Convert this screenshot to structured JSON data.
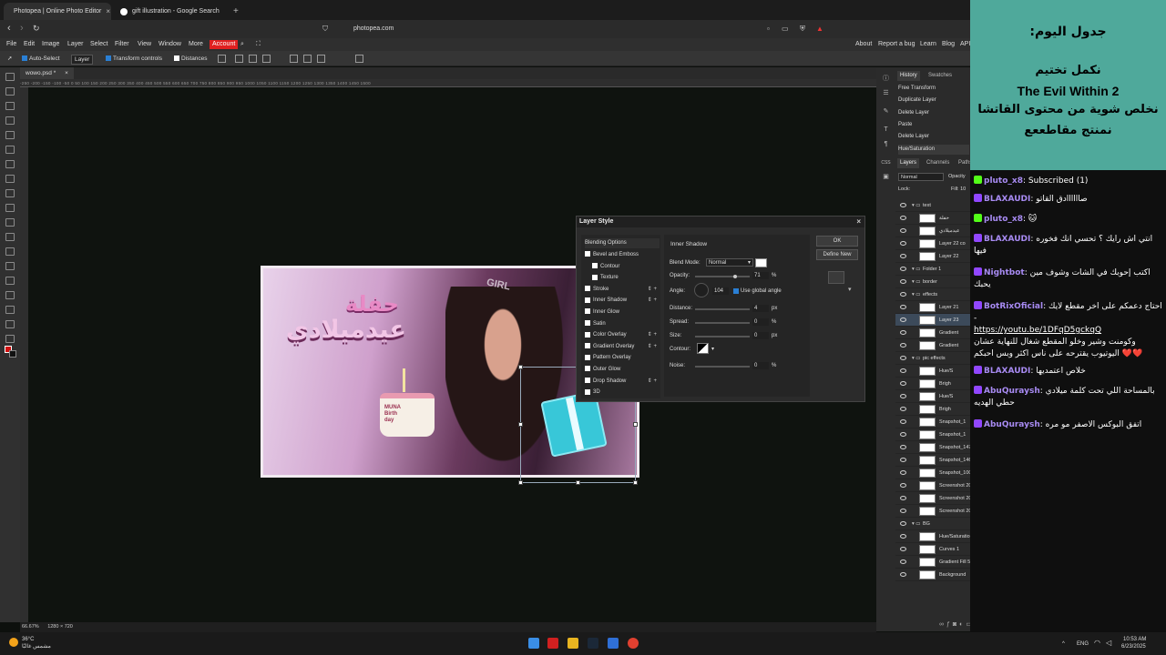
{
  "browser": {
    "tabs": [
      {
        "label": "Photopea | Online Photo Editor",
        "close": "×"
      },
      {
        "label": "gift illustration - Google Search",
        "close": "×"
      }
    ],
    "new_tab": "+",
    "url": "photopea.com"
  },
  "menu": {
    "items": [
      "File",
      "Edit",
      "Image",
      "Layer",
      "Select",
      "Filter",
      "View",
      "Window",
      "More"
    ],
    "account": "Account",
    "right_links": [
      "About",
      "Report a bug",
      "Learn",
      "Blog",
      "API"
    ]
  },
  "options": {
    "auto_select": "Auto-Select",
    "layer_select": "Layer",
    "transform_controls": "Transform controls",
    "distances": "Distances"
  },
  "document": {
    "tab": "wowo.psd *",
    "ruler": "-250 -200 -150 -100 -50 0 50 100 150 200 250 300 350 400 450 500 550 600 650 700 750 800 850 900 950 1000 1050 1100 1150 1200 1250 1300 1350 1400 1450 1500",
    "zoom": "66.67%",
    "size": "1280 × 720"
  },
  "artwork": {
    "title_line1": "حفلة",
    "title_line2": "عيدميلادي",
    "tiara": "GIRL",
    "cake_text": "MUNA\nBirth\nday"
  },
  "dialog": {
    "title": "Layer Style",
    "close": "×",
    "blending_options": "Blending Options",
    "styles": [
      {
        "label": "Bevel and Emboss",
        "indent": false,
        "plus": false
      },
      {
        "label": "Contour",
        "indent": true,
        "plus": false
      },
      {
        "label": "Texture",
        "indent": true,
        "plus": false
      },
      {
        "label": "Stroke",
        "indent": false,
        "plus": true
      },
      {
        "label": "Inner Shadow",
        "indent": false,
        "plus": true
      },
      {
        "label": "Inner Glow",
        "indent": false,
        "plus": false
      },
      {
        "label": "Satin",
        "indent": false,
        "plus": false
      },
      {
        "label": "Color Overlay",
        "indent": false,
        "plus": true
      },
      {
        "label": "Gradient Overlay",
        "indent": false,
        "plus": true
      },
      {
        "label": "Pattern Overlay",
        "indent": false,
        "plus": false
      },
      {
        "label": "Outer Glow",
        "indent": false,
        "plus": false
      },
      {
        "label": "Drop Shadow",
        "indent": false,
        "plus": true
      },
      {
        "label": "3D",
        "indent": false,
        "plus": false
      }
    ],
    "section": "Inner Shadow",
    "blend_mode_label": "Blend Mode:",
    "blend_mode": "Normal",
    "opacity_label": "Opacity:",
    "opacity": "71",
    "angle_label": "Angle:",
    "angle": "104",
    "global_angle": "Use global angle",
    "distance_label": "Distance:",
    "distance": "4",
    "spread_label": "Spread:",
    "spread": "0",
    "size_label": "Size:",
    "size": "0",
    "contour_label": "Contour:",
    "noise_label": "Noise:",
    "noise": "0",
    "unit_px": "px",
    "unit_pct": "%",
    "ok": "OK",
    "define_new": "Define New"
  },
  "history": {
    "tabs": [
      "History",
      "Swatches"
    ],
    "items": [
      "Free Transform",
      "Duplicate Layer",
      "Delete Layer",
      "Paste",
      "Delete Layer",
      "Hue/Saturation"
    ]
  },
  "layers": {
    "tabs": [
      "Layers",
      "Channels",
      "Paths"
    ],
    "blend": "Normal",
    "opacity_label": "Opacity",
    "lock_label": "Lock:",
    "fill_label": "Fill: 10",
    "items": [
      "text",
      "حفلة",
      "عيدميلادي",
      "Layer 22 co",
      "Layer 22",
      "Folder 1",
      "border",
      "effects",
      "Layer 21",
      "Layer 23",
      "Gradient",
      "Gradient",
      "pic effects",
      "Hue/S",
      "Brigh",
      "Hue/S",
      "Brigh",
      "Snapshot_1",
      "Snapshot_1",
      "Snapshot_147",
      "Snapshot_146",
      "Snapshot_100",
      "Screenshot 2025-06-1",
      "Screenshot 2025-06-1",
      "Screenshot 2025-06-0",
      "BG",
      "Hue/Saturation 2",
      "Curves 1",
      "Gradient Fill 5",
      "Background"
    ]
  },
  "stream": {
    "schedule": [
      "جدول اليوم:",
      "نكمل تختيم",
      "The Evil Within 2",
      "نخلص شوية من محتوى القاتشا",
      "نمنتج مقاطععع"
    ],
    "chat": [
      {
        "user": "pluto_x8",
        "text": "Subscribed (1)",
        "badge_color": "#53fc18"
      },
      {
        "user": "BLAXAUDI",
        "text": "صاااااادق القاتو",
        "badge_color": "#9147ff"
      },
      {
        "user": "pluto_x8",
        "text": "🐱",
        "badge_color": "#53fc18"
      },
      {
        "user": "BLAXAUDI",
        "text": "انتي اش رايك ؟ تحسي انك فخوره فيها",
        "badge_color": "#9147ff"
      },
      {
        "user": "Nightbot",
        "text": "اكتب إحوبك في الشات وشوف مين يحبك",
        "badge_color": "#9147ff"
      },
      {
        "user": "BotRixOficial",
        "text": "احتاج دعمكم على اخر مقطع لايك -",
        "link": "https://youtu.be/1DFqD5gckqQ",
        "tail": "وكومنت وشير وخلو المقطع شغال للنهاية عشان اليوتيوب يقترحه على ناس اكثر وبس احبكم ❤️❤️",
        "badge_color": "#9147ff"
      },
      {
        "user": "BLAXAUDI",
        "text": "خلاص اعتمديها",
        "badge_color": "#9147ff"
      },
      {
        "user": "AbuQuraysh",
        "text": "بالمساحة اللي تحت كلمة ميلادي حطي الهديه",
        "badge_color": "#9147ff"
      },
      {
        "user": "AbuQuraysh",
        "text": "اتفق البوكس الاصفر مو مره",
        "badge_color": "#9147ff"
      }
    ]
  },
  "taskbar": {
    "weather_temp": "36°C",
    "weather_desc": "مشمس غالبًا",
    "lang": "ENG",
    "time": "10:53 AM",
    "date": "6/23/2025"
  }
}
